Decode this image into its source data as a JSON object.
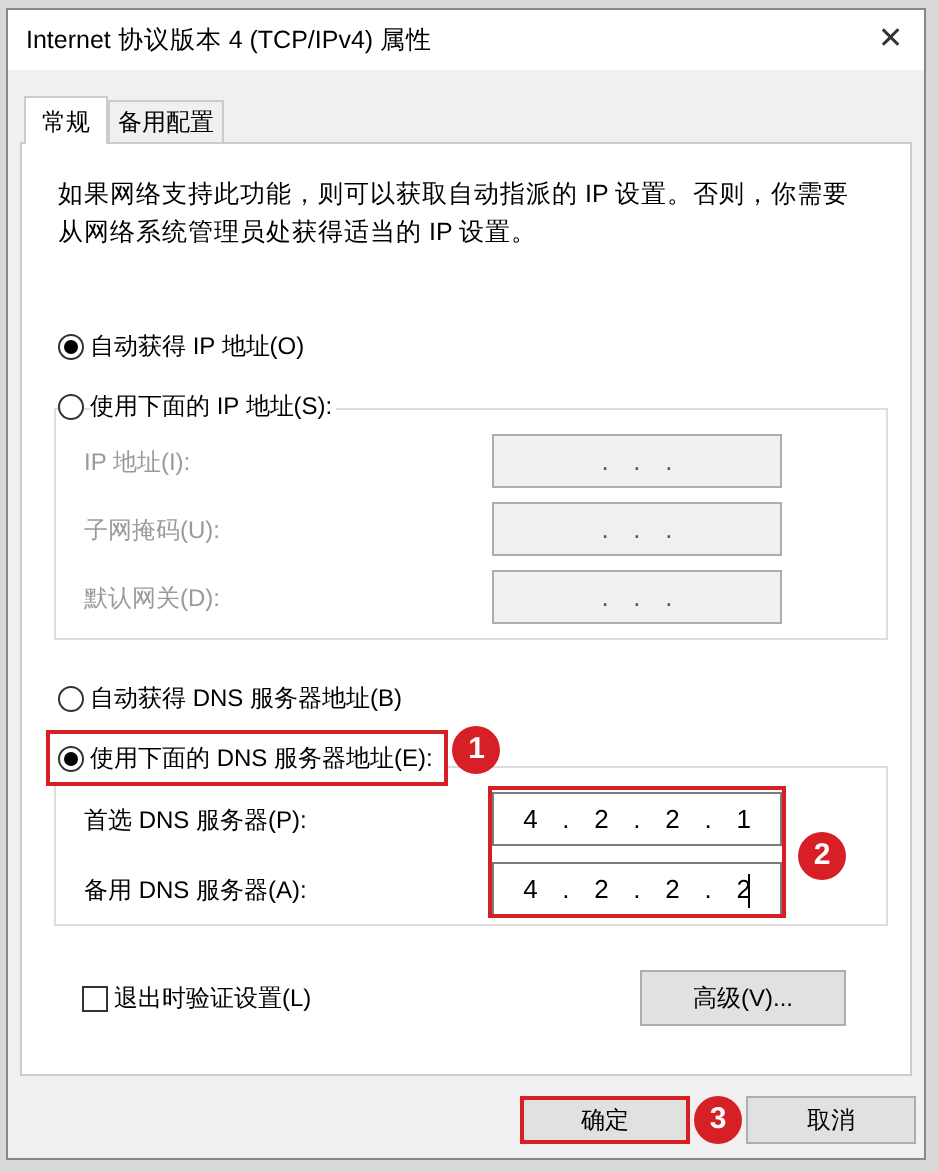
{
  "window": {
    "title": "Internet 协议版本 4 (TCP/IPv4) 属性",
    "close": "✕"
  },
  "tabs": [
    {
      "label": "常规",
      "selected": true
    },
    {
      "label": "备用配置",
      "selected": false
    }
  ],
  "description": "如果网络支持此功能，则可以获取自动指派的 IP 设置。否则，你需要从网络系统管理员处获得适当的 IP 设置。",
  "ip_mode": [
    {
      "label": "自动获得 IP 地址(O)",
      "selected": true
    },
    {
      "label": "使用下面的 IP 地址(S):",
      "selected": false
    }
  ],
  "ip_fields": [
    {
      "label": "IP 地址(I):",
      "value": "...",
      "disabled": true
    },
    {
      "label": "子网掩码(U):",
      "value": "...",
      "disabled": true
    },
    {
      "label": "默认网关(D):",
      "value": "...",
      "disabled": true
    }
  ],
  "dns_mode": [
    {
      "label": "自动获得 DNS 服务器地址(B)",
      "selected": false
    },
    {
      "label": "使用下面的 DNS 服务器地址(E):",
      "selected": true,
      "annotation": "1"
    }
  ],
  "dns_group": {
    "annotation": "2",
    "fields": [
      {
        "label": "首选 DNS 服务器(P):",
        "value": "4.2.2.1",
        "disabled": false,
        "focused": false
      },
      {
        "label": "备用 DNS 服务器(A):",
        "value": "4.2.2.2",
        "disabled": false,
        "focused": true
      }
    ]
  },
  "validate": {
    "label": "退出时验证设置(L)",
    "checked": false
  },
  "advanced_button": "高级(V)...",
  "buttons": [
    {
      "label": "确定",
      "annotation": "3"
    },
    {
      "label": "取消"
    }
  ]
}
